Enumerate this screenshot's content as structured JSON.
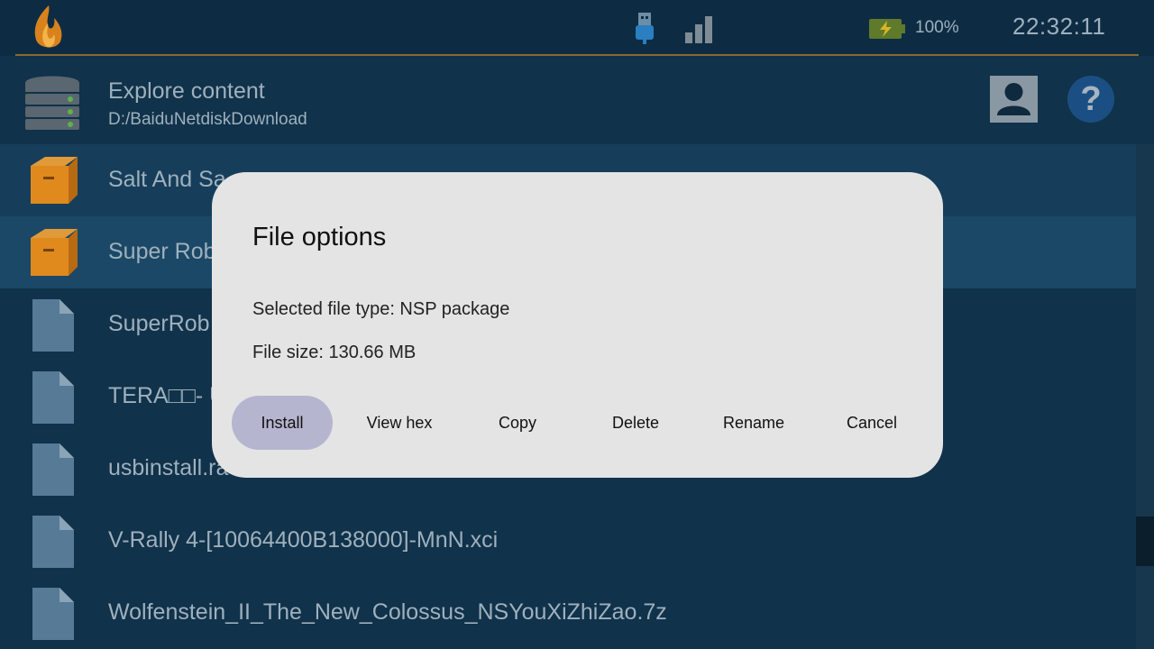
{
  "status_bar": {
    "battery_percent": "100%",
    "time": "22:32:11",
    "icons": [
      "app-logo-icon",
      "usb-icon",
      "signal-icon",
      "battery-charging-icon"
    ]
  },
  "header": {
    "title": "Explore content",
    "path": "D:/BaiduNetdiskDownload"
  },
  "files": [
    {
      "name": "Salt And Sa",
      "icon": "package-box-icon"
    },
    {
      "name": "Super Rob",
      "icon": "package-box-icon"
    },
    {
      "name": "SuperRob",
      "icon": "file-icon"
    },
    {
      "name": "TERA□□- U",
      "icon": "file-icon"
    },
    {
      "name": "usbinstall.ra",
      "icon": "file-icon"
    },
    {
      "name": "V-Rally 4-[10064400B138000]-MnN.xci",
      "icon": "file-icon"
    },
    {
      "name": "Wolfenstein_II_The_New_Colossus_NSYouXiZhiZao.7z",
      "icon": "file-icon"
    }
  ],
  "dialog": {
    "title": "File options",
    "file_type": "Selected file type: NSP package",
    "file_size": "File size: 130.66 MB",
    "buttons": {
      "install": "Install",
      "view_hex": "View hex",
      "copy": "Copy",
      "delete": "Delete",
      "rename": "Rename",
      "cancel": "Cancel"
    }
  },
  "colors": {
    "background": "#10324a",
    "selected_row": "#1b4866",
    "dialog_bg": "#e4e4e4",
    "primary_button": "#b5b5cf",
    "accent_rule": "#8a6a2c"
  }
}
